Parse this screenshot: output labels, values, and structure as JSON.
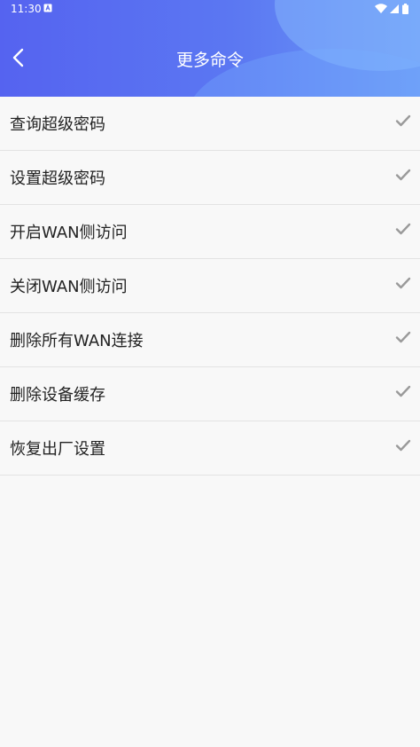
{
  "status": {
    "time": "11:30",
    "notification_icon": "a-square-icon",
    "wifi_icon": "wifi-icon",
    "signal_icon": "cell-signal-icon",
    "battery_icon": "battery-icon"
  },
  "header": {
    "title": "更多命令",
    "back_icon": "chevron-left-icon"
  },
  "commands": [
    {
      "label": "查询超级密码",
      "icon": "check-icon"
    },
    {
      "label": "设置超级密码",
      "icon": "check-icon"
    },
    {
      "label": "开启WAN侧访问",
      "icon": "check-icon"
    },
    {
      "label": "关闭WAN侧访问",
      "icon": "check-icon"
    },
    {
      "label": "删除所有WAN连接",
      "icon": "check-icon"
    },
    {
      "label": "删除设备缓存",
      "icon": "check-icon"
    },
    {
      "label": "恢复出厂设置",
      "icon": "check-icon"
    }
  ],
  "colors": {
    "header_start": "#5563f0",
    "header_end": "#6a9af6",
    "check": "#9a9a9a",
    "text": "#222222",
    "background": "#f8f8f8"
  }
}
